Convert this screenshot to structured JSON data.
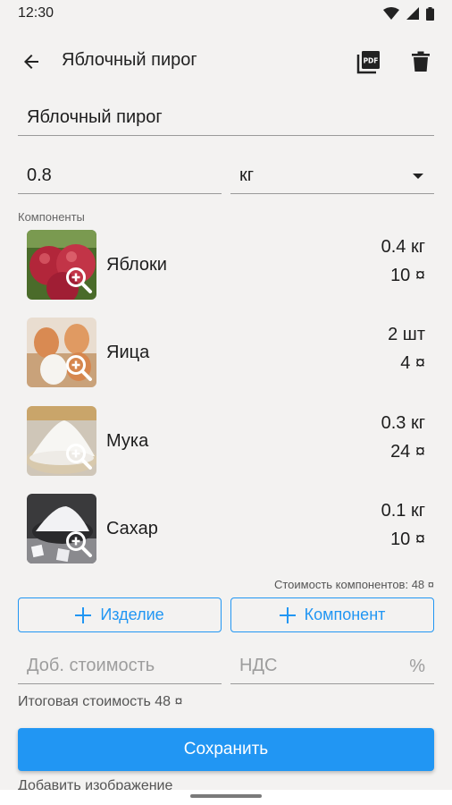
{
  "status_bar": {
    "time": "12:30"
  },
  "app_bar": {
    "title": "Яблочный пирог"
  },
  "form": {
    "name_value": "Яблочный пирог",
    "quantity_value": "0.8",
    "unit_value": "кг"
  },
  "components_label": "Компоненты",
  "components": [
    {
      "name": "Яблоки",
      "amount": "0.4 кг",
      "cost": "10 ¤",
      "image": "apple-photo"
    },
    {
      "name": "Яица",
      "amount": "2 шт",
      "cost": "4 ¤",
      "image": "eggs-photo"
    },
    {
      "name": "Мука",
      "amount": "0.3 кг",
      "cost": "24 ¤",
      "image": "flour-photo"
    },
    {
      "name": "Сахар",
      "amount": "0.1 кг",
      "cost": "10 ¤",
      "image": "sugar-photo"
    }
  ],
  "components_cost": "Стоимость компонентов: 48 ¤",
  "buttons": {
    "add_product": "Изделие",
    "add_component": "Компонент",
    "save": "Сохранить"
  },
  "extra_cost_placeholder": "Доб. стоимость",
  "vat_placeholder": "НДС",
  "vat_suffix": "%",
  "total_cost": "Итоговая стоимость 48 ¤",
  "add_image": "Добавить изображение",
  "colors": {
    "accent": "#2196f3",
    "background": "#f3f2f1"
  }
}
